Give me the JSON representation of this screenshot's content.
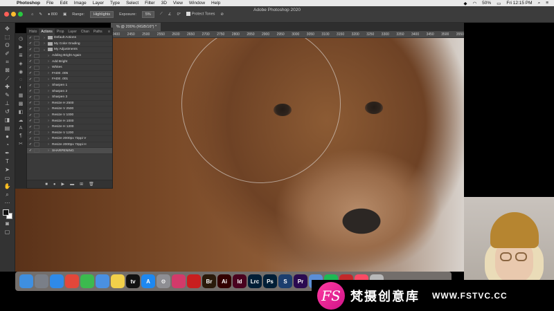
{
  "menubar": {
    "apple_glyph": "",
    "items": [
      "Photoshop",
      "File",
      "Edit",
      "Image",
      "Layer",
      "Type",
      "Select",
      "Filter",
      "3D",
      "View",
      "Window",
      "Help"
    ],
    "battery": "50%",
    "datetime": "Fri 12:15 PM"
  },
  "window": {
    "title": "Adobe Photoshop 2020"
  },
  "options_bar": {
    "brush_size": "800",
    "range_label": "Range:",
    "range_value": "Highlights",
    "exposure_label": "Exposure:",
    "exposure_value": "5%",
    "angle_value": "0°",
    "protect_tones_label": "Protect Tones"
  },
  "document_tab": {
    "label": "% @ 200% (RGB/16*) *"
  },
  "ruler": {
    "ticks": [
      "2400",
      "2450",
      "2500",
      "2550",
      "2600",
      "2650",
      "2700",
      "2750",
      "2800",
      "2850",
      "2900",
      "2950",
      "3000",
      "3050",
      "3100",
      "3150",
      "3200",
      "3250",
      "3300",
      "3350",
      "3400",
      "3450",
      "3500",
      "3550"
    ]
  },
  "panel": {
    "tabs": [
      "Histo",
      "Actions",
      "Prop",
      "Layer",
      "Chan",
      "Paths"
    ],
    "active_tab": "Actions",
    "actions": [
      {
        "label": "Default Actions",
        "level": 0,
        "folder": true
      },
      {
        "label": "My Color Grading",
        "level": 0,
        "folder": true
      },
      {
        "label": "My Adjustments",
        "level": 0,
        "folder": true,
        "open": true
      },
      {
        "label": "Adding Bright Again",
        "level": 1
      },
      {
        "label": "Add Bright",
        "level": 1
      },
      {
        "label": "Whites",
        "level": 1
      },
      {
        "label": "FADE .005",
        "level": 1
      },
      {
        "label": "FADE .001",
        "level": 1
      },
      {
        "label": "Sharpen 1",
        "level": 1
      },
      {
        "label": "Sharpen 2",
        "level": 1
      },
      {
        "label": "Sharpen 3",
        "level": 1
      },
      {
        "label": "Resize H 2500",
        "level": 1
      },
      {
        "label": "Resize V 2500",
        "level": 1
      },
      {
        "label": "Resize V 1000",
        "level": 1
      },
      {
        "label": "Resize H 1000",
        "level": 1
      },
      {
        "label": "Resize H 1200",
        "level": 1
      },
      {
        "label": "Resize V 1200",
        "level": 1
      },
      {
        "label": "Resize 2000px 72ppi V",
        "level": 1
      },
      {
        "label": "Resize 2000px 72ppi H",
        "level": 1
      },
      {
        "label": "SHARPENING",
        "level": 1,
        "selected": true
      }
    ]
  },
  "dock": {
    "apps": [
      {
        "name": "finder-icon",
        "label": "",
        "color": "#3f8fe0"
      },
      {
        "name": "launchpad-icon",
        "label": "",
        "color": "#7a7f88"
      },
      {
        "name": "safari-icon",
        "label": "",
        "color": "#2f8ae8"
      },
      {
        "name": "chrome-icon",
        "label": "",
        "color": "#e3473a"
      },
      {
        "name": "facetime-icon",
        "label": "",
        "color": "#3cba4e"
      },
      {
        "name": "messages-icon",
        "label": "",
        "color": "#4a90e2"
      },
      {
        "name": "notes-icon",
        "label": "",
        "color": "#f2d04a"
      },
      {
        "name": "appletv-icon",
        "label": "tv",
        "color": "#111111"
      },
      {
        "name": "appstore-icon",
        "label": "A",
        "color": "#1e88f0"
      },
      {
        "name": "settings-icon",
        "label": "⚙",
        "color": "#8e8e93"
      },
      {
        "name": "creative-cloud-icon",
        "label": "",
        "color": "#d23a6a"
      },
      {
        "name": "acrobat-icon",
        "label": "",
        "color": "#c81e1e"
      },
      {
        "name": "bridge-icon",
        "label": "Br",
        "color": "#2a1a0a"
      },
      {
        "name": "illustrator-icon",
        "label": "Ai",
        "color": "#330000"
      },
      {
        "name": "indesign-icon",
        "label": "Id",
        "color": "#49021f"
      },
      {
        "name": "lightroom-classic-icon",
        "label": "Lrc",
        "color": "#001e36"
      },
      {
        "name": "photoshop-icon",
        "label": "Ps",
        "color": "#001e36"
      },
      {
        "name": "sketchbook-icon",
        "label": "S",
        "color": "#1c3e6e"
      },
      {
        "name": "premiere-icon",
        "label": "Pr",
        "color": "#2a0a50"
      },
      {
        "name": "folder-icon",
        "label": "",
        "color": "#5b8ed6"
      },
      {
        "name": "spotify-icon",
        "label": "",
        "color": "#1db954"
      },
      {
        "name": "app-red-icon",
        "label": "",
        "color": "#c2282a"
      },
      {
        "name": "music-icon",
        "label": "♪",
        "color": "#fa4a64"
      },
      {
        "name": "trash-icon",
        "label": "",
        "color": "#b8b8b8"
      }
    ]
  },
  "watermark": {
    "logo_letters": "FS",
    "chinese_name": "梵摄创意库",
    "url": "WWW.FSTVC.CC"
  }
}
